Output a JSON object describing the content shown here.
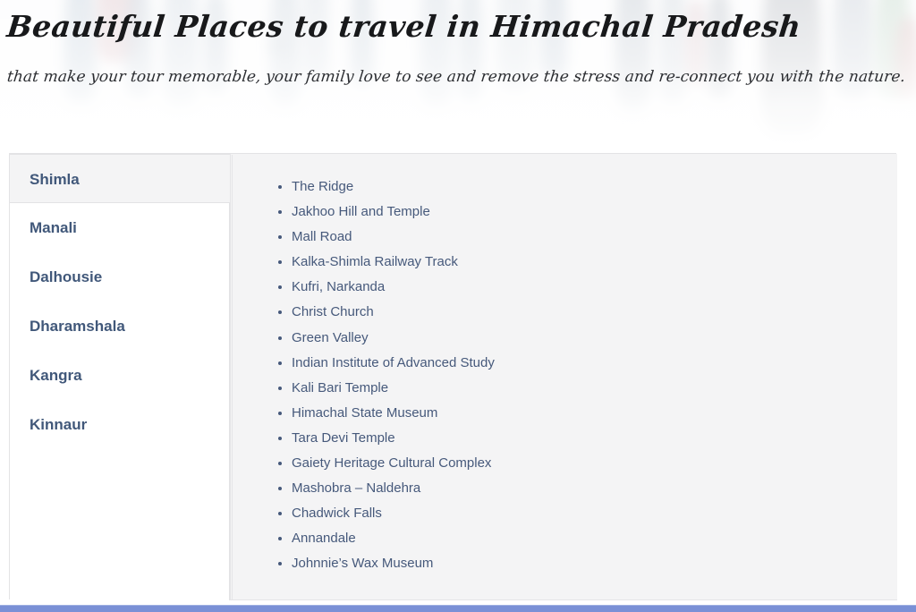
{
  "hero": {
    "title": "Beautiful Places to travel in Himachal Pradesh",
    "subtitle": "that make your tour memorable, your family love to see and remove the stress and re-connect you with the nature.",
    "background_image_alt": "faded photo of people walking",
    "title_color": "#18191b",
    "subtitle_color": "#2b2d31",
    "background_color": "#fbfbfc"
  },
  "tabs": {
    "active_index": 0,
    "items": [
      {
        "label": "Shimla"
      },
      {
        "label": "Manali"
      },
      {
        "label": "Dalhousie"
      },
      {
        "label": "Dharamshala"
      },
      {
        "label": "Kangra"
      },
      {
        "label": "Kinnaur"
      }
    ],
    "label_color": "#41587a",
    "active_background": "#f4f4f5",
    "inactive_background": "#ffffff",
    "border_color": "#e3e3e5"
  },
  "content": {
    "panel_background": "#f4f4f5",
    "text_color": "#46597b",
    "places": [
      "The Ridge",
      "Jakhoo Hill and Temple",
      "Mall Road",
      "Kalka-Shimla Railway Track",
      "Kufri, Narkanda",
      "Christ Church",
      "Green Valley",
      "Indian Institute of Advanced Study",
      "Kali Bari Temple",
      "Himachal State Museum",
      "Tara Devi Temple",
      "Gaiety Heritage Cultural Complex",
      "Mashobra – Naldehra",
      "Chadwick Falls",
      "Annandale",
      "Johnnie’s Wax Museum"
    ]
  },
  "footer": {
    "accent_color": "#7a90d6"
  }
}
